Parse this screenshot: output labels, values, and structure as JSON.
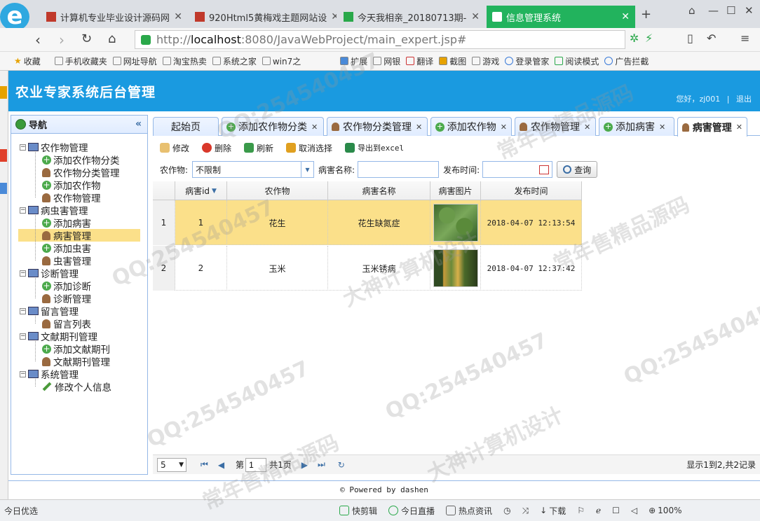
{
  "browser": {
    "tabs": [
      {
        "label": "计算机专业毕业设计源码网",
        "favicon": "flag-icon"
      },
      {
        "label": "920Html5黄梅戏主题网站设",
        "favicon": "flag-icon"
      },
      {
        "label": "今天我相亲_20180713期-",
        "favicon": "video-icon"
      },
      {
        "label": "信息管理系统",
        "favicon": "page-icon"
      }
    ],
    "new_tab": "+",
    "url_host": "localhost",
    "url_path": ":8080/JavaWebProject/main_expert.jsp#",
    "url_prefix": "http://",
    "bookmarks": [
      "收藏",
      "手机收藏夹",
      "网址导航",
      "淘宝热卖",
      "系统之家",
      "win7之"
    ],
    "extras": [
      "扩展",
      "网银",
      "翻译",
      "截图",
      "游戏",
      "登录管家",
      "阅读模式",
      "广告拦截"
    ]
  },
  "app": {
    "title": "农业专家系统后台管理",
    "greeting": "您好，zj001",
    "separator": "|",
    "logout": "退出",
    "accent": "#1a9ae0"
  },
  "nav": {
    "title": "导航",
    "collapse": "«",
    "groups": [
      {
        "label": "农作物管理",
        "items": [
          {
            "label": "添加农作物分类",
            "icon": "add"
          },
          {
            "label": "农作物分类管理",
            "icon": "user"
          },
          {
            "label": "添加农作物",
            "icon": "add"
          },
          {
            "label": "农作物管理",
            "icon": "user"
          }
        ]
      },
      {
        "label": "病虫害管理",
        "items": [
          {
            "label": "添加病害",
            "icon": "add"
          },
          {
            "label": "病害管理",
            "icon": "user"
          },
          {
            "label": "添加虫害",
            "icon": "add"
          },
          {
            "label": "虫害管理",
            "icon": "user"
          }
        ]
      },
      {
        "label": "诊断管理",
        "items": [
          {
            "label": "添加诊断",
            "icon": "add"
          },
          {
            "label": "诊断管理",
            "icon": "user"
          }
        ]
      },
      {
        "label": "留言管理",
        "items": [
          {
            "label": "留言列表",
            "icon": "user"
          }
        ]
      },
      {
        "label": "文献期刊管理",
        "items": [
          {
            "label": "添加文献期刊",
            "icon": "add"
          },
          {
            "label": "文献期刊管理",
            "icon": "user"
          }
        ]
      },
      {
        "label": "系统管理",
        "items": [
          {
            "label": "修改个人信息",
            "icon": "pen"
          }
        ]
      }
    ]
  },
  "main_tabs": [
    {
      "label": "起始页",
      "icon": "",
      "closable": false
    },
    {
      "label": "添加农作物分类",
      "icon": "add",
      "closable": true
    },
    {
      "label": "农作物分类管理",
      "icon": "user",
      "closable": true
    },
    {
      "label": "添加农作物",
      "icon": "add",
      "closable": true
    },
    {
      "label": "农作物管理",
      "icon": "user",
      "closable": true
    },
    {
      "label": "添加病害",
      "icon": "add",
      "closable": true
    },
    {
      "label": "病害管理",
      "icon": "user",
      "closable": true
    }
  ],
  "toolbar": {
    "edit": "修改",
    "delete": "删除",
    "refresh": "刷新",
    "cancel_select": "取消选择",
    "export": "导出到excel"
  },
  "search": {
    "crop_label": "农作物:",
    "crop_value": "不限制",
    "name_label": "病害名称:",
    "name_value": "",
    "time_label": "发布时间:",
    "time_value": "",
    "query": "查询"
  },
  "grid": {
    "columns": [
      "病害id",
      "农作物",
      "病害名称",
      "病害图片",
      "发布时间"
    ],
    "rows": [
      {
        "num": "1",
        "id": "1",
        "crop": "花生",
        "name": "花生缺氮症",
        "time": "2018-04-07 12:13:54"
      },
      {
        "num": "2",
        "id": "2",
        "crop": "玉米",
        "name": "玉米锈病",
        "time": "2018-04-07 12:37:42"
      }
    ]
  },
  "pager": {
    "page_size": "5",
    "page_label": "第",
    "page": "1",
    "total_label": "共1页",
    "summary": "显示1到2,共2记录"
  },
  "footer": "© Powered by dashen",
  "status": {
    "left": "今日优选",
    "items": [
      "快剪辑",
      "今日直播",
      "热点资讯",
      "下载"
    ],
    "zoom": "100%"
  },
  "watermarks": [
    "QQ:254540457",
    "常年售精品源码",
    "大神计算机设计"
  ]
}
